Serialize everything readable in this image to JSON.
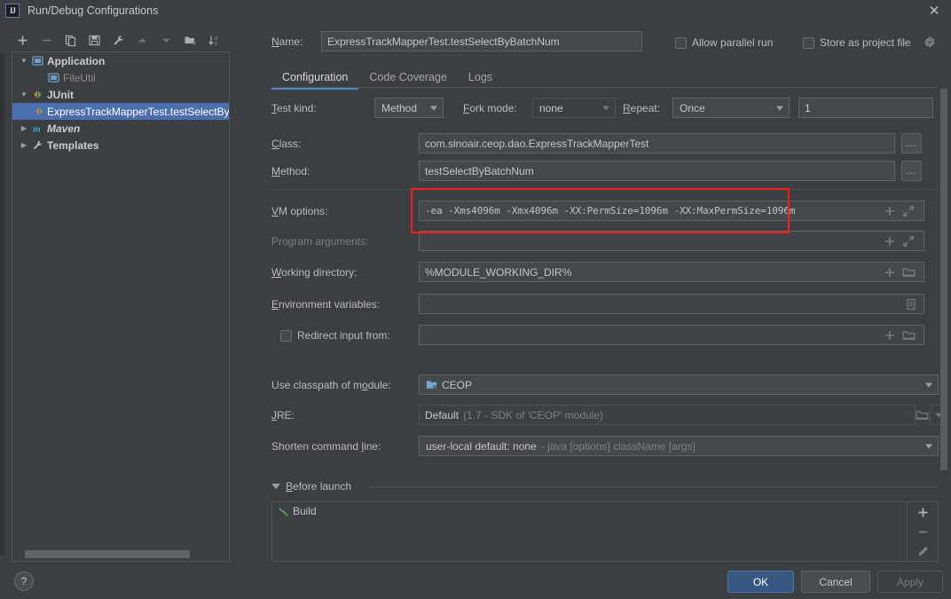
{
  "window": {
    "title": "Run/Debug Configurations",
    "app_icon": "intellij-idea-icon",
    "close_label": "✕"
  },
  "toolbar": {
    "buttons": [
      {
        "name": "add-configuration-button",
        "icon": "plus-icon",
        "label": "+"
      },
      {
        "name": "remove-configuration-button",
        "icon": "minus-icon",
        "label": "−"
      },
      {
        "name": "copy-configuration-button",
        "icon": "copy-icon",
        "label": "Copy"
      },
      {
        "name": "save-configuration-button",
        "icon": "save-icon",
        "label": "Save"
      },
      {
        "name": "edit-templates-button",
        "icon": "wrench-icon",
        "label": "Edit Templates"
      },
      {
        "name": "move-up-button",
        "icon": "arrow-up-icon",
        "label": "Move Up"
      },
      {
        "name": "move-down-button",
        "icon": "arrow-down-icon",
        "label": "Move Down"
      },
      {
        "name": "new-folder-button",
        "icon": "folder-add-icon",
        "label": "New Folder"
      },
      {
        "name": "sort-alphabetically-button",
        "icon": "sort-az-icon",
        "label": "Sort"
      }
    ]
  },
  "tree": {
    "items": [
      {
        "label": "Application",
        "icon": "application-icon",
        "level": 0,
        "expanded": true,
        "bold": true,
        "selected": false,
        "dim": false
      },
      {
        "label": "FileUtil",
        "icon": "application-icon",
        "level": 1,
        "expanded": null,
        "bold": false,
        "selected": false,
        "dim": true
      },
      {
        "label": "JUnit",
        "icon": "junit-icon",
        "level": 0,
        "expanded": true,
        "bold": true,
        "selected": false,
        "dim": false
      },
      {
        "label": "ExpressTrackMapperTest.testSelectByBatchNum",
        "icon": "junit-icon",
        "level": 1,
        "expanded": null,
        "bold": false,
        "selected": true,
        "dim": false
      },
      {
        "label": "Maven",
        "icon": "maven-icon",
        "level": 0,
        "expanded": false,
        "bold": true,
        "selected": false,
        "dim": false
      },
      {
        "label": "Templates",
        "icon": "wrench-icon",
        "level": 0,
        "expanded": false,
        "bold": true,
        "selected": false,
        "dim": false
      }
    ]
  },
  "header": {
    "name_label": "Name:",
    "name_value": "ExpressTrackMapperTest.testSelectByBatchNum",
    "allow_parallel_run_label": "Allow parallel run",
    "allow_parallel_run_checked": false,
    "store_as_project_file_label": "Store as project file",
    "store_as_project_file_checked": false,
    "gear_icon": "gear-icon"
  },
  "tabs": [
    {
      "label": "Configuration",
      "active": true
    },
    {
      "label": "Code Coverage",
      "active": false
    },
    {
      "label": "Logs",
      "active": false
    }
  ],
  "form": {
    "test_kind_label": "Test kind:",
    "test_kind_value": "Method",
    "fork_mode_label": "Fork mode:",
    "fork_mode_value": "none",
    "repeat_label": "Repeat:",
    "repeat_value": "Once",
    "repeat_count": "1",
    "class_label": "Class:",
    "class_value": "com.sinoair.ceop.dao.ExpressTrackMapperTest",
    "method_label": "Method:",
    "method_value": "testSelectByBatchNum",
    "vm_options_label": "VM options:",
    "vm_options_value": "-ea -Xms4096m -Xmx4096m -XX:PermSize=1096m -XX:MaxPermSize=1096m",
    "program_arguments_label": "Program arguments:",
    "program_arguments_value": "",
    "working_directory_label": "Working directory:",
    "working_directory_value": "%MODULE_WORKING_DIR%",
    "environment_variables_label": "Environment variables:",
    "environment_variables_value": "",
    "redirect_input_label": "Redirect input from:",
    "redirect_input_checked": false,
    "redirect_input_value": "",
    "use_classpath_label": "Use classpath of module:",
    "use_classpath_value": "CEOP",
    "jre_label": "JRE:",
    "jre_value": "Default",
    "jre_hint": "(1.7 - SDK of 'CEOP' module)",
    "shorten_command_line_label": "Shorten command line:",
    "shorten_command_line_value": "user-local default: none",
    "shorten_command_line_hint": "- java [options] className [args]",
    "dots_button_label": "...",
    "highlight_color": "#ff1a1a",
    "highlight_target": "vm_options"
  },
  "before_launch": {
    "title": "Before launch",
    "expanded": true,
    "items": [
      {
        "label": "Build",
        "icon": "build-hammer-icon"
      }
    ],
    "side_buttons": [
      {
        "name": "before-launch-add-button",
        "icon": "plus-icon",
        "label": "+"
      },
      {
        "name": "before-launch-remove-button",
        "icon": "minus-icon",
        "label": "−"
      },
      {
        "name": "before-launch-edit-button",
        "icon": "pencil-icon",
        "label": "Edit"
      }
    ]
  },
  "footer": {
    "help_label": "?",
    "ok_label": "OK",
    "cancel_label": "Cancel",
    "apply_label": "Apply",
    "apply_enabled": false
  }
}
